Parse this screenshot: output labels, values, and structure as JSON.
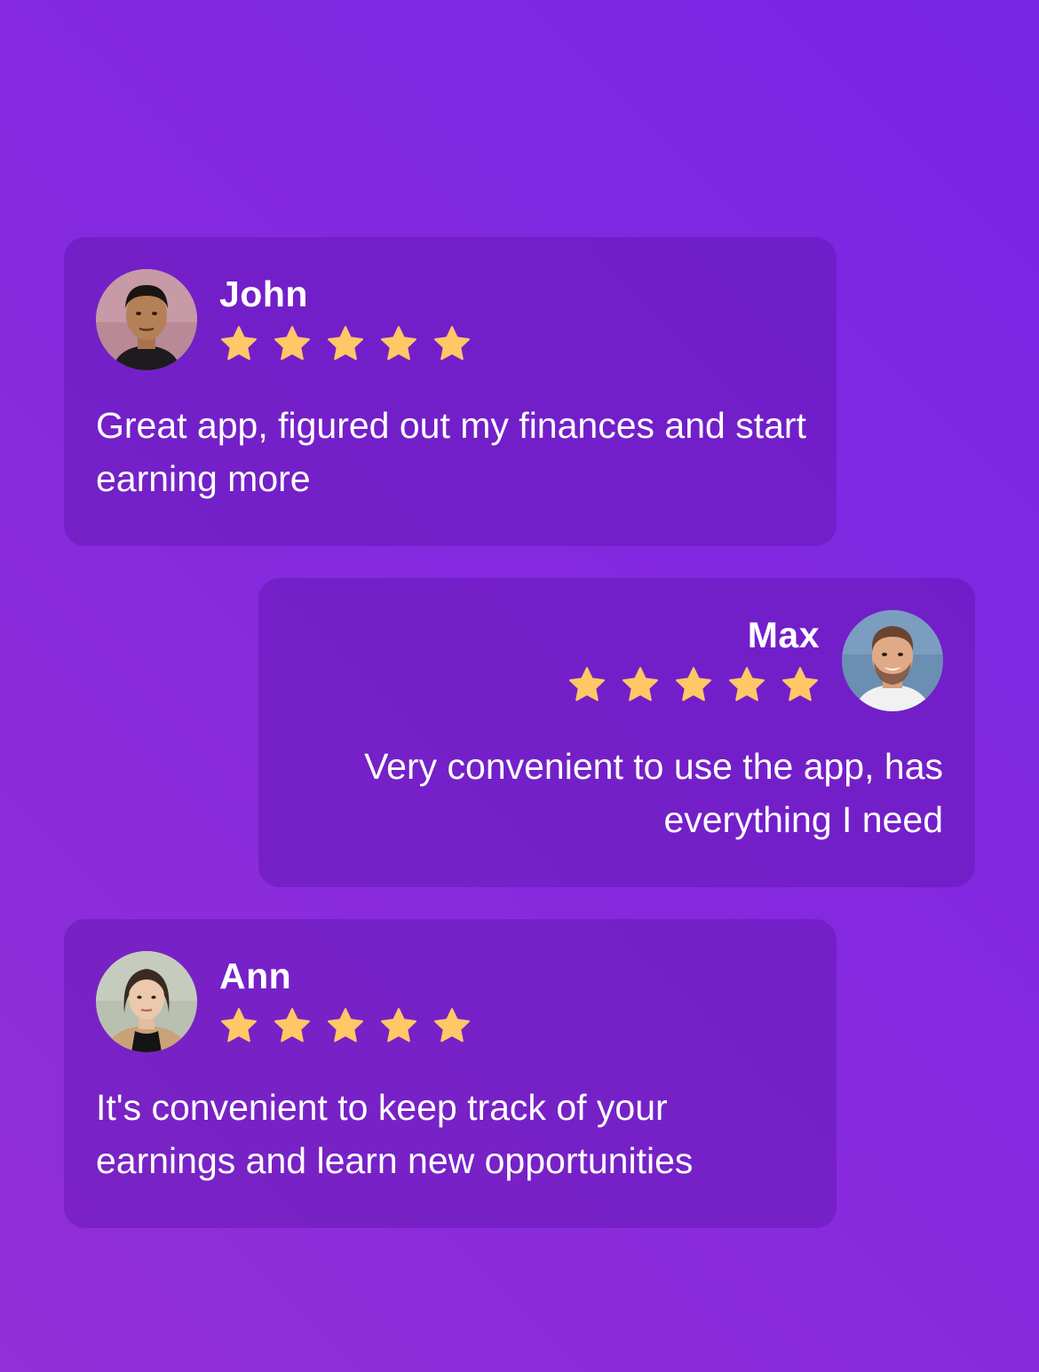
{
  "accent": {
    "star": "#ffc766",
    "background": "#8429e0"
  },
  "reviews": [
    {
      "name": "John",
      "rating": 5,
      "avatar_icon": "avatar-john",
      "text": "Great app, figured out my finances and start earning more"
    },
    {
      "name": "Max",
      "rating": 5,
      "avatar_icon": "avatar-max",
      "text": "Very convenient to use the app, has everything I need"
    },
    {
      "name": "Ann",
      "rating": 5,
      "avatar_icon": "avatar-ann",
      "text": "It's convenient to keep track of your earnings and learn new opportunities"
    }
  ]
}
